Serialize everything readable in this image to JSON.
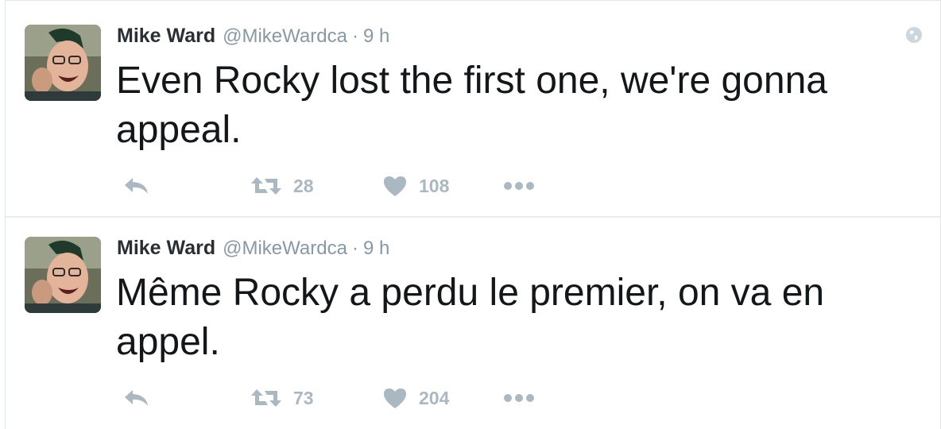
{
  "tweets": [
    {
      "author_name": "Mike Ward",
      "author_handle": "@MikeWardca",
      "separator": "·",
      "time": "9 h",
      "text": "Even Rocky lost the first one, we're gonna appeal.",
      "retweets": "28",
      "likes": "108"
    },
    {
      "author_name": "Mike Ward",
      "author_handle": "@MikeWardca",
      "separator": "·",
      "time": "9 h",
      "text": "Même Rocky a perdu le premier, on va en appel.",
      "retweets": "73",
      "likes": "204"
    }
  ],
  "icons": {
    "reply": "reply-icon",
    "retweet": "retweet-icon",
    "like": "heart-icon",
    "more": "more-dots-icon",
    "globe": "globe-icon"
  },
  "colors": {
    "action_gray": "#aab8c2",
    "meta_gray": "#8899a6",
    "text": "#14171a"
  }
}
